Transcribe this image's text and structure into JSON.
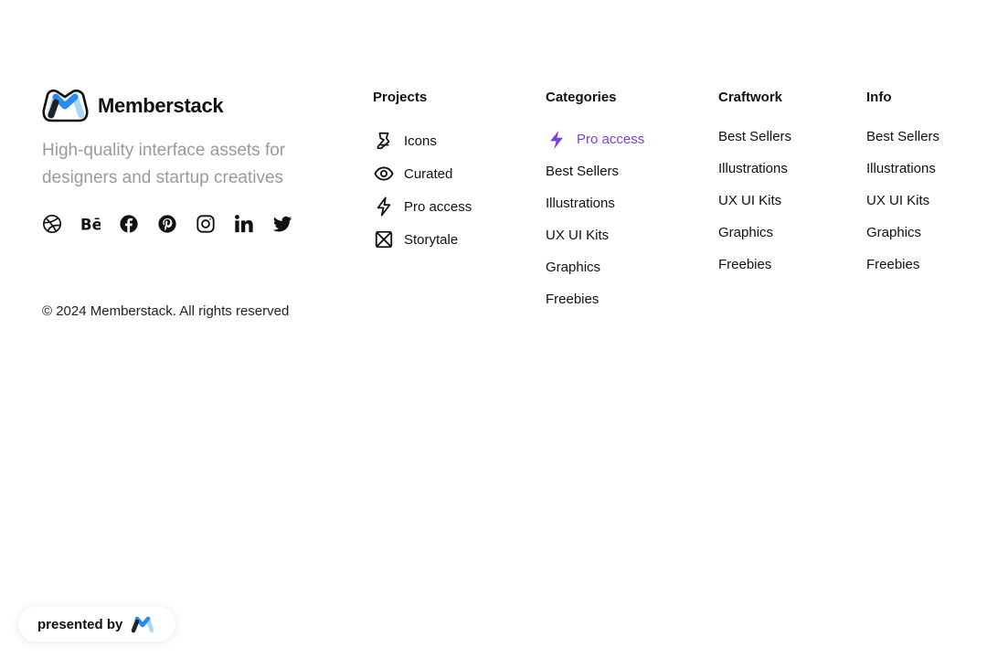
{
  "brand": {
    "name": "Memberstack",
    "tagline": "High-quality interface assets for designers and startup creatives",
    "colors": {
      "logo_blue": "#2a8cf0",
      "logo_light_blue": "#a7d6fb",
      "logo_dark": "#222222"
    }
  },
  "socials": [
    {
      "icon": "dribbble-icon"
    },
    {
      "icon": "behance-icon"
    },
    {
      "icon": "facebook-icon"
    },
    {
      "icon": "pinterest-icon"
    },
    {
      "icon": "instagram-icon"
    },
    {
      "icon": "linkedin-icon"
    },
    {
      "icon": "twitter-icon"
    }
  ],
  "copyright": "© 2024 Memberstack. All rights reserved",
  "projects": {
    "title": "Projects",
    "items": [
      {
        "label": "Icons",
        "icon": "pen-tool-icon"
      },
      {
        "label": "Curated",
        "icon": "eye-icon"
      },
      {
        "label": "Pro access",
        "icon": "lightning-icon"
      },
      {
        "label": "Storytale",
        "icon": "storytale-icon"
      }
    ]
  },
  "categories": {
    "title": "Categories",
    "accent_color": "#7b3fe4",
    "items": [
      {
        "label": "Pro access",
        "icon": "lightning-icon",
        "highlighted": true
      },
      {
        "label": "Best Sellers"
      },
      {
        "label": "Illustrations"
      },
      {
        "label": "UX UI Kits"
      },
      {
        "label": "Graphics"
      },
      {
        "label": "Freebies"
      }
    ]
  },
  "craftwork": {
    "title": "Craftwork",
    "items": [
      {
        "label": "Best Sellers"
      },
      {
        "label": "Illustrations"
      },
      {
        "label": "UX UI Kits"
      },
      {
        "label": "Graphics"
      },
      {
        "label": "Freebies"
      }
    ]
  },
  "info": {
    "title": "Info",
    "items": [
      {
        "label": "Best Sellers"
      },
      {
        "label": "Illustrations"
      },
      {
        "label": "UX UI Kits"
      },
      {
        "label": "Graphics"
      },
      {
        "label": "Freebies"
      }
    ]
  },
  "badge": {
    "label": "presented by"
  }
}
